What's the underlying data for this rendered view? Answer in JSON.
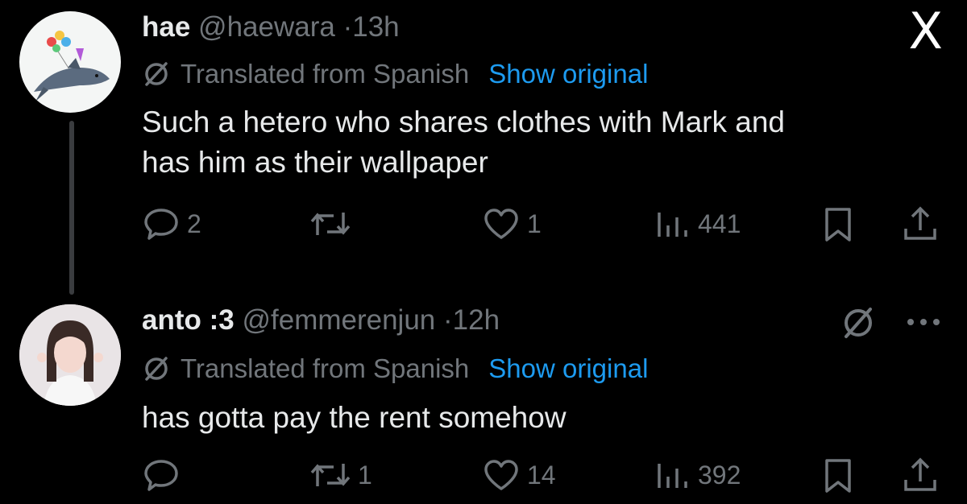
{
  "app": {
    "logo_text": "X"
  },
  "tweets": [
    {
      "name": "hae",
      "handle": "@haewara",
      "dot": "·",
      "time": "13h",
      "translated_label": "Translated from Spanish",
      "show_original": "Show original",
      "text_line1": "Such a hetero who shares clothes with Mark and",
      "text_line2": "has him as their wallpaper",
      "actions": {
        "replies": "2",
        "reposts": "",
        "likes": "1",
        "views": "441"
      }
    },
    {
      "name": "anto :3",
      "handle": "@femmerenjun",
      "dot": "·",
      "time": "12h",
      "translated_label": "Translated from Spanish",
      "show_original": "Show original",
      "text_line1": "has gotta pay the rent somehow",
      "actions": {
        "replies": "",
        "reposts": "1",
        "likes": "14",
        "views": "392"
      }
    }
  ],
  "colors": {
    "accent": "#1d9bf0",
    "muted": "#71767b",
    "text": "#e7e9ea",
    "background": "#000000"
  },
  "icons": [
    "x-logo-icon",
    "translate-icon",
    "reply-icon",
    "repost-icon",
    "like-icon",
    "views-icon",
    "bookmark-icon",
    "share-icon",
    "more-icon"
  ]
}
